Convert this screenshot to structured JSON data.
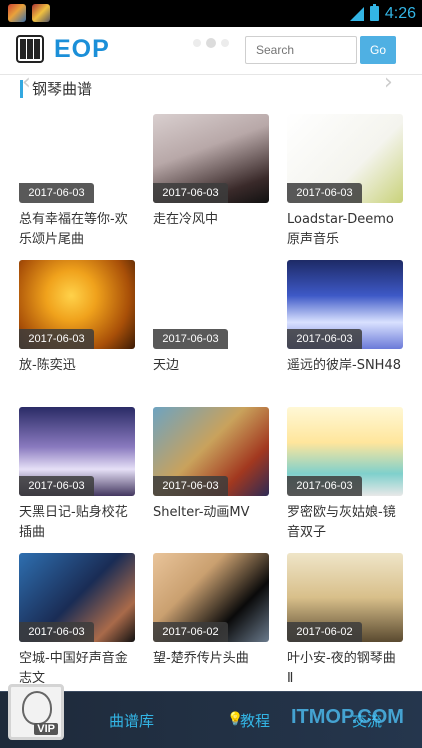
{
  "status_bar": {
    "time": "4:26"
  },
  "header": {
    "logo_text": "EOP",
    "search": {
      "placeholder": "Search",
      "button_label": "Go"
    }
  },
  "section": {
    "title": "钢琴曲谱"
  },
  "cards": [
    {
      "date": "2017-06-03",
      "title": "总有幸福在等你-欢乐颂片尾曲"
    },
    {
      "date": "2017-06-03",
      "title": "走在冷风中"
    },
    {
      "date": "2017-06-03",
      "title": "Loadstar-Deemo原声音乐"
    },
    {
      "date": "2017-06-03",
      "title": "放-陈奕迅"
    },
    {
      "date": "2017-06-03",
      "title": "天边"
    },
    {
      "date": "2017-06-03",
      "title": "遥远的彼岸-SNH48"
    },
    {
      "date": "2017-06-03",
      "title": "天黑日记-贴身校花插曲"
    },
    {
      "date": "2017-06-03",
      "title": "Shelter-动画MV"
    },
    {
      "date": "2017-06-03",
      "title": "罗密欧与灰姑娘-镜音双子"
    },
    {
      "date": "2017-06-03",
      "title": "空城-中国好声音金志文"
    },
    {
      "date": "2017-06-02",
      "title": "望-楚乔传片头曲"
    },
    {
      "date": "2017-06-02",
      "title": "叶小安-夜的钢琴曲 Ⅱ"
    }
  ],
  "bottom_nav": {
    "vip_label": "VIP",
    "library": "曲谱库",
    "tutorial": "教程",
    "third": "交流",
    "watermark": "ITMOP.COM"
  }
}
